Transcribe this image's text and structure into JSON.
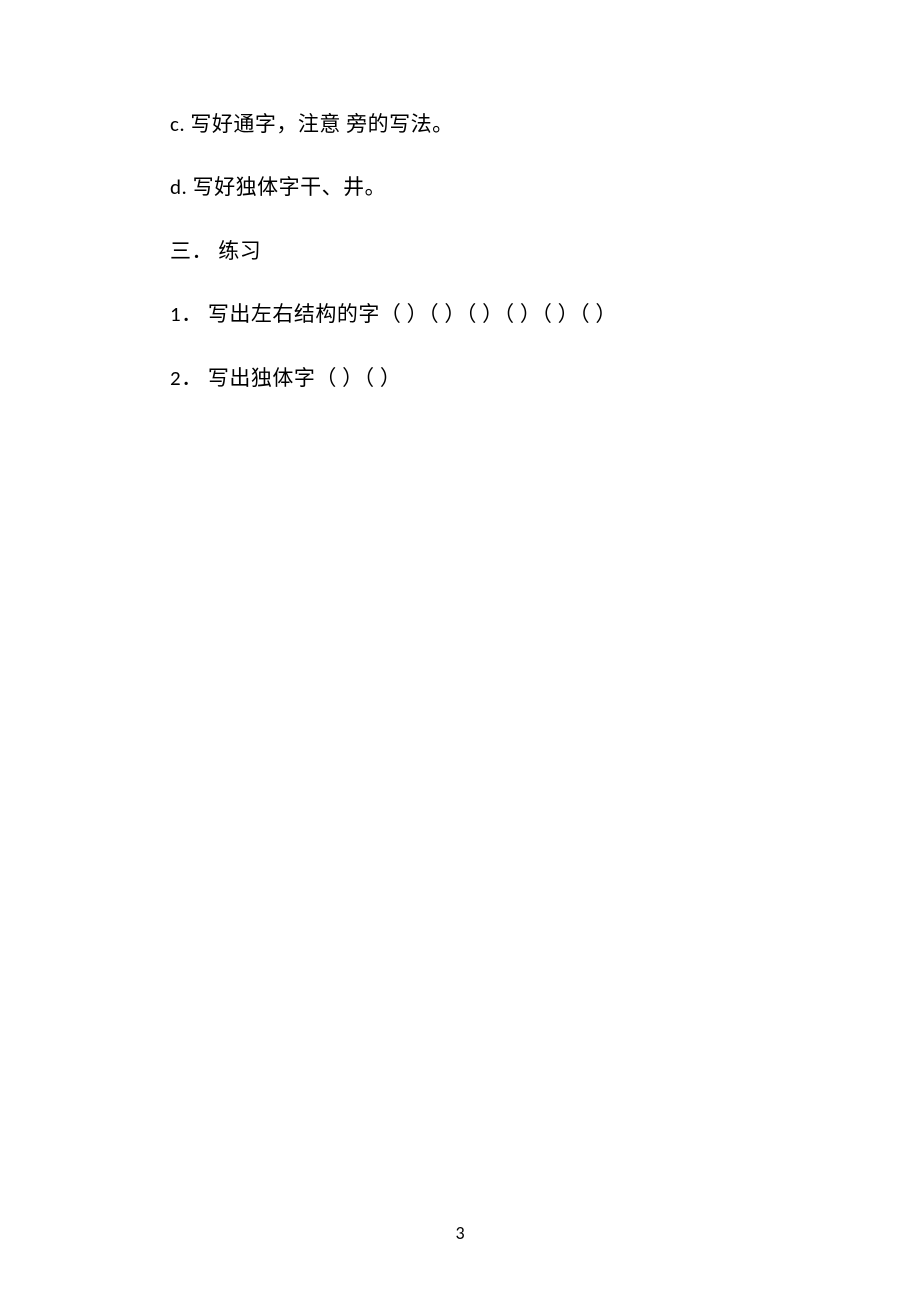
{
  "lines": {
    "c": "c.  写好通字，注意  旁的写法。",
    "d": "d.  写好独体字干、井。",
    "three": "三．  练习",
    "one": "1．  写出左右结构的字（ ）（ ）（ ）（ ）（ ）（ ）",
    "two": "2．  写出独体字（ ）（ ）"
  },
  "page_number": "3"
}
